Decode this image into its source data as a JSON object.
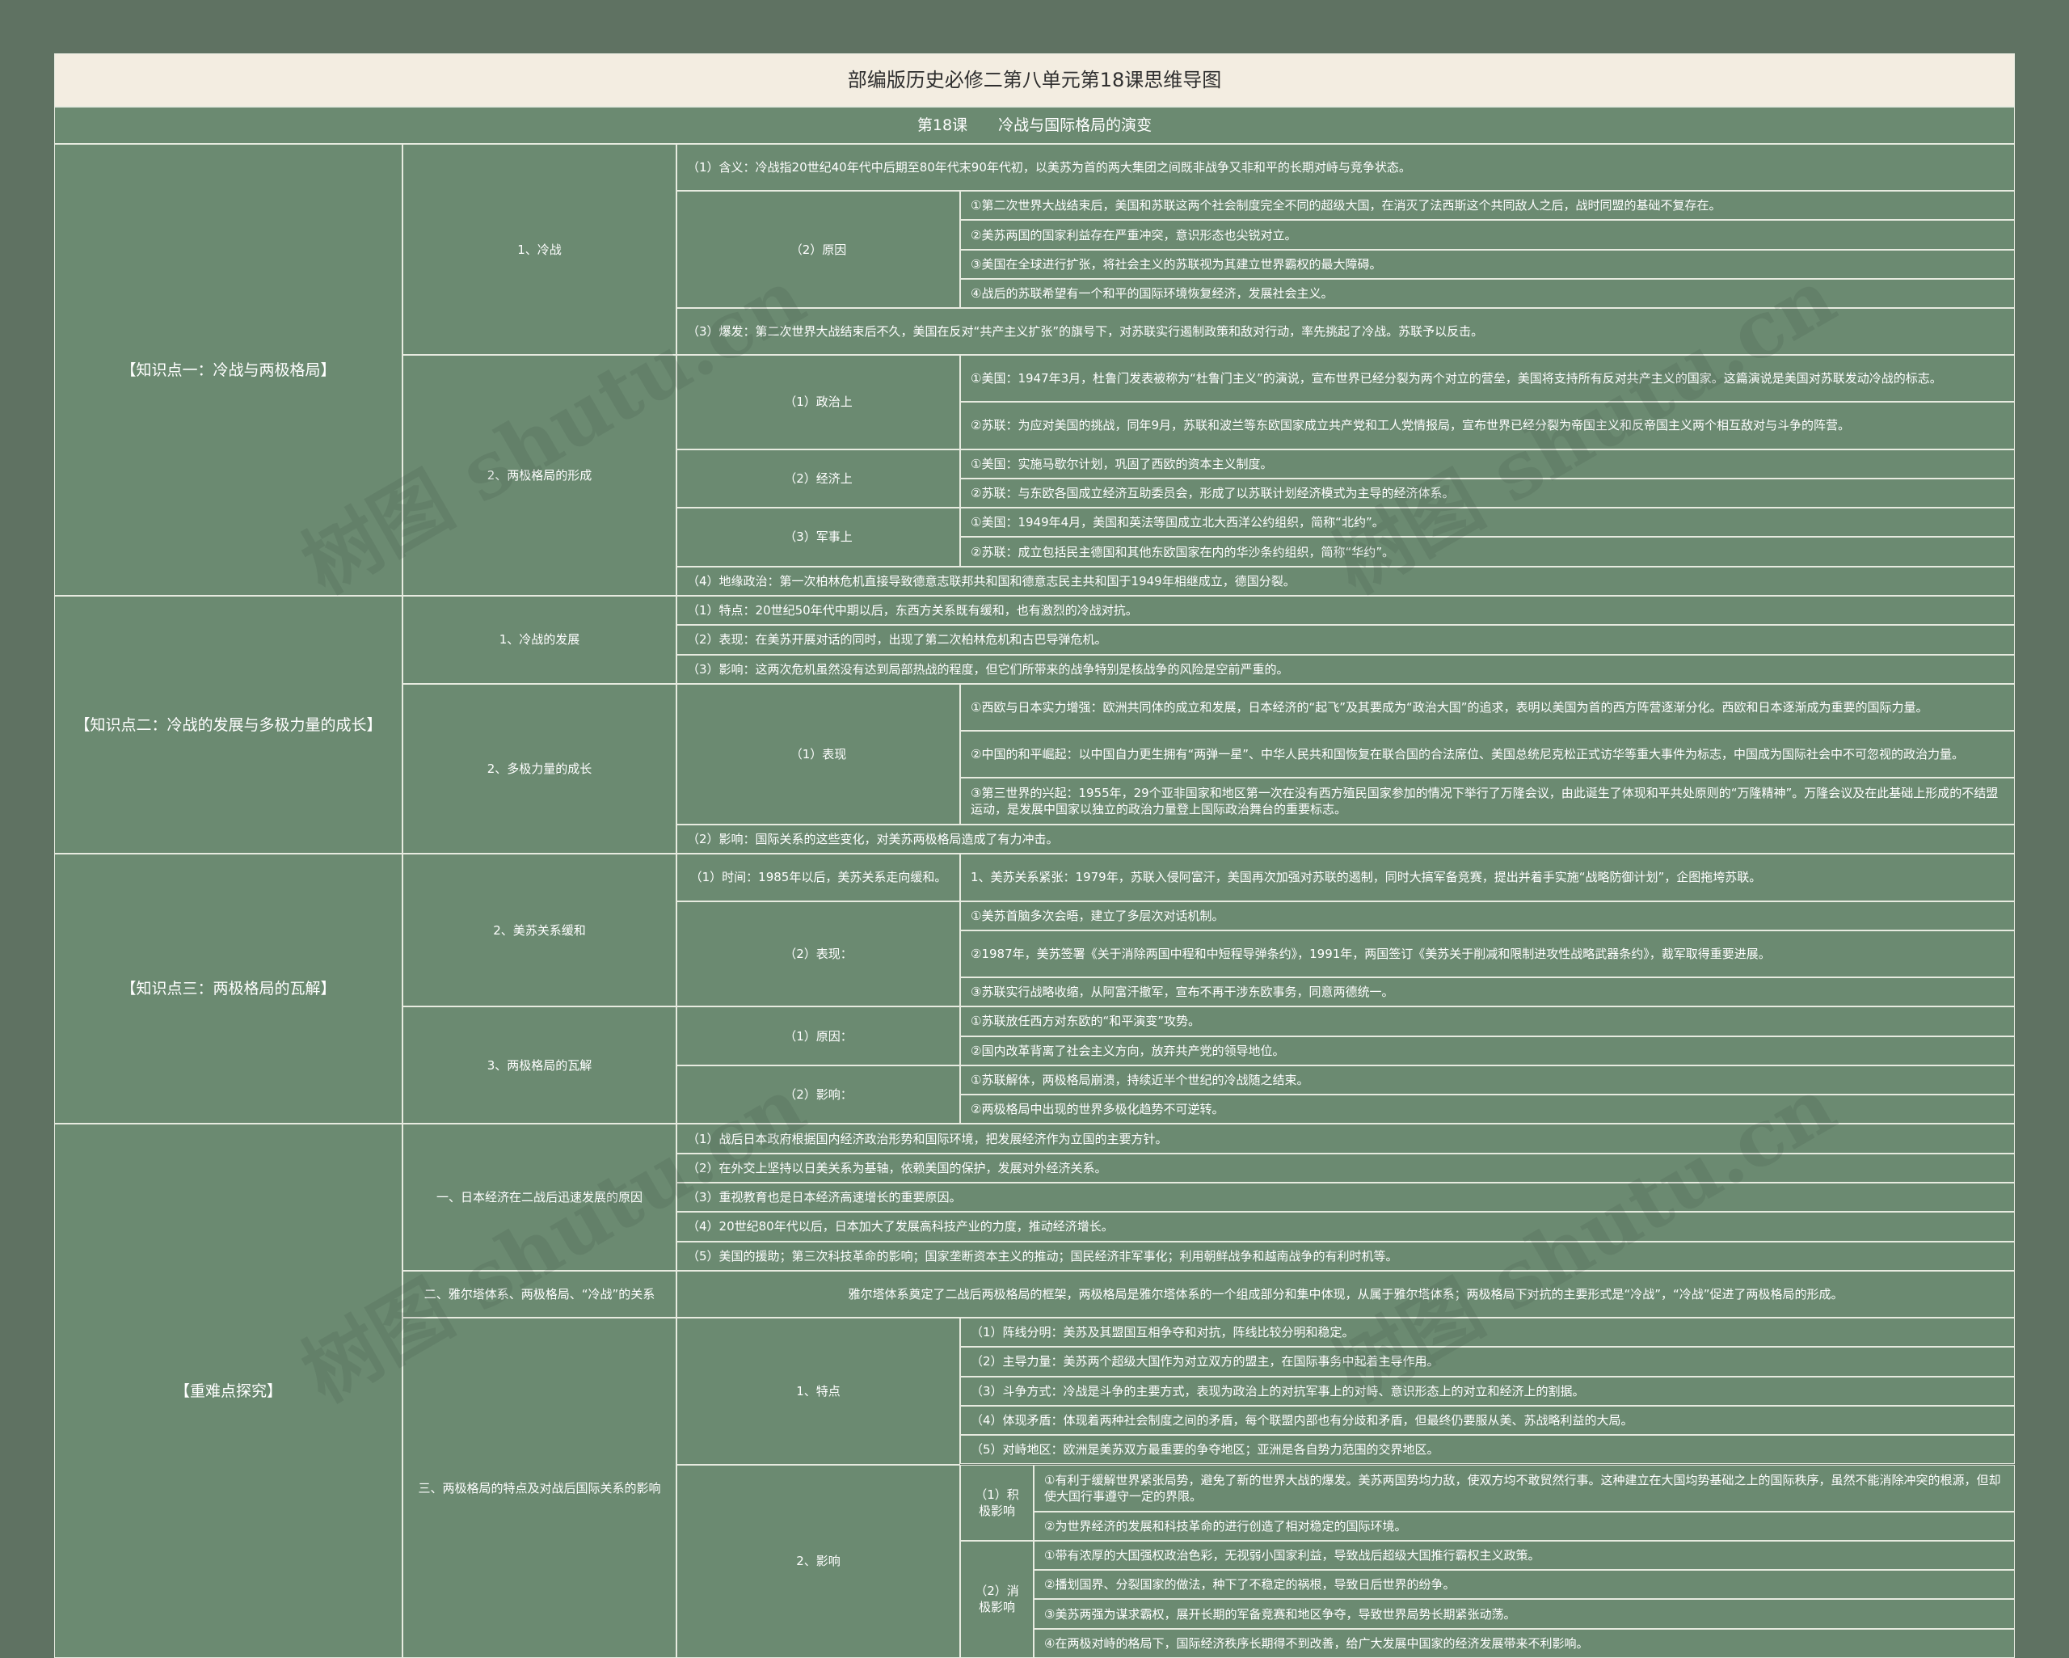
{
  "title": "部编版历史必修二第八单元第18课思维导图",
  "subtitle": "第18课　　冷战与国际格局的演变",
  "watermark": "树图 shutu.cn",
  "sections": [
    {
      "name": "【知识点一：冷战与两极格局】",
      "level2": [
        {
          "name": "1、冷战",
          "level3": [
            {
              "text": "（1）含义：冷战指20世纪40年代中后期至80年代末90年代初，以美苏为首的两大集团之间既非战争又非和平的长期对峙与竞争状态。"
            },
            {
              "name": "（2）原因",
              "level4": [
                "①第二次世界大战结束后，美国和苏联这两个社会制度完全不同的超级大国，在消灭了法西斯这个共同敌人之后，战时同盟的基础不复存在。",
                "②美苏两国的国家利益存在严重冲突，意识形态也尖锐对立。",
                "③美国在全球进行扩张，将社会主义的苏联视为其建立世界霸权的最大障碍。",
                "④战后的苏联希望有一个和平的国际环境恢复经济，发展社会主义。"
              ]
            },
            {
              "text": "（3）爆发：第二次世界大战结束后不久，美国在反对“共产主义扩张”的旗号下，对苏联实行遏制政策和敌对行动，率先挑起了冷战。苏联予以反击。"
            }
          ]
        },
        {
          "name": "2、两极格局的形成",
          "level3": [
            {
              "name": "（1）政治上",
              "level4": [
                "①美国：1947年3月，杜鲁门发表被称为“杜鲁门主义”的演说，宣布世界已经分裂为两个对立的营垒，美国将支持所有反对共产主义的国家。这篇演说是美国对苏联发动冷战的标志。",
                "②苏联：为应对美国的挑战，同年9月，苏联和波兰等东欧国家成立共产党和工人党情报局，宣布世界已经分裂为帝国主义和反帝国主义两个相互敌对与斗争的阵营。"
              ]
            },
            {
              "name": "（2）经济上",
              "level4": [
                "①美国：实施马歇尔计划，巩固了西欧的资本主义制度。",
                "②苏联：与东欧各国成立经济互助委员会，形成了以苏联计划经济模式为主导的经济体系。"
              ]
            },
            {
              "name": "（3）军事上",
              "level4": [
                "①美国：1949年4月，美国和英法等国成立北大西洋公约组织，简称“北约”。",
                "②苏联：成立包括民主德国和其他东欧国家在内的华沙条约组织，简称“华约”。"
              ]
            },
            {
              "text": "（4）地缘政治：第一次柏林危机直接导致德意志联邦共和国和德意志民主共和国于1949年相继成立，德国分裂。"
            }
          ]
        }
      ]
    },
    {
      "name": "【知识点二：冷战的发展与多极力量的成长】",
      "level2": [
        {
          "name": "1、冷战的发展",
          "level3": [
            {
              "text": "（1）特点：20世纪50年代中期以后，东西方关系既有缓和，也有激烈的冷战对抗。"
            },
            {
              "text": "（2）表现：在美苏开展对话的同时，出现了第二次柏林危机和古巴导弹危机。"
            },
            {
              "text": "（3）影响：这两次危机虽然没有达到局部热战的程度，但它们所带来的战争特别是核战争的风险是空前严重的。"
            }
          ]
        },
        {
          "name": "2、多极力量的成长",
          "level3": [
            {
              "name": "（1）表现",
              "level4": [
                "①西欧与日本实力增强：欧洲共同体的成立和发展，日本经济的“起飞”及其要成为“政治大国”的追求，表明以美国为首的西方阵营逐渐分化。西欧和日本逐渐成为重要的国际力量。",
                "②中国的和平崛起：以中国自力更生拥有“两弹一星”、中华人民共和国恢复在联合国的合法席位、美国总统尼克松正式访华等重大事件为标志，中国成为国际社会中不可忽视的政治力量。",
                "③第三世界的兴起：1955年，29个亚非国家和地区第一次在没有西方殖民国家参加的情况下举行了万隆会议，由此诞生了体现和平共处原则的“万隆精神”。万隆会议及在此基础上形成的不结盟运动，是发展中国家以独立的政治力量登上国际政治舞台的重要标志。"
              ]
            },
            {
              "text": "（2）影响：国际关系的这些变化，对美苏两极格局造成了有力冲击。"
            }
          ]
        }
      ]
    },
    {
      "name": "【知识点三：两极格局的瓦解】",
      "level2": [
        {
          "name": "2、美苏关系缓和",
          "level3": [
            {
              "name": "（1）时间：1985年以后，美苏关系走向缓和。",
              "level4": [
                "1、美苏关系紧张：1979年，苏联入侵阿富汗，美国再次加强对苏联的遏制，同时大搞军备竞赛，提出并着手实施“战略防御计划”，企图拖垮苏联。"
              ]
            },
            {
              "name": "（2）表现：",
              "level4": [
                "①美苏首脑多次会晤，建立了多层次对话机制。",
                "②1987年，美苏签署《关于消除两国中程和中短程导弹条约》，1991年，两国签订《美苏关于削减和限制进攻性战略武器条约》，裁军取得重要进展。",
                "③苏联实行战略收缩，从阿富汗撤军，宣布不再干涉东欧事务，同意两德统一。"
              ]
            }
          ]
        },
        {
          "name": "3、两极格局的瓦解",
          "level3": [
            {
              "name": "（1）原因：",
              "level4": [
                "①苏联放任西方对东欧的“和平演变”攻势。",
                "②国内改革背离了社会主义方向，放弃共产党的领导地位。"
              ]
            },
            {
              "name": "（2）影响：",
              "level4": [
                "①苏联解体，两极格局崩溃，持续近半个世纪的冷战随之结束。",
                "②两极格局中出现的世界多极化趋势不可逆转。"
              ]
            }
          ]
        }
      ]
    },
    {
      "name": "【重难点探究】",
      "level2": [
        {
          "name": "一、日本经济在二战后迅速发展的原因",
          "level3": [
            {
              "text": "（1）战后日本政府根据国内经济政治形势和国际环境，把发展经济作为立国的主要方针。"
            },
            {
              "text": "（2）在外交上坚持以日美关系为基轴，依赖美国的保护，发展对外经济关系。"
            },
            {
              "text": "（3）重视教育也是日本经济高速增长的重要原因。"
            },
            {
              "text": "（4）20世纪80年代以后，日本加大了发展高科技产业的力度，推动经济增长。"
            },
            {
              "text": "（5）美国的援助；第三次科技革命的影响；国家垄断资本主义的推动；国民经济非军事化；利用朝鲜战争和越南战争的有利时机等。"
            }
          ]
        },
        {
          "name": "二、雅尔塔体系、两极格局、“冷战”的关系",
          "text": "雅尔塔体系奠定了二战后两极格局的框架，两极格局是雅尔塔体系的一个组成部分和集中体现，从属于雅尔塔体系；两极格局下对抗的主要形式是“冷战”，“冷战”促进了两极格局的形成。"
        },
        {
          "name": "三、两极格局的特点及对战后国际关系的影响",
          "level3": [
            {
              "name": "1、特点",
              "level4": [
                "（1）阵线分明：美苏及其盟国互相争夺和对抗，阵线比较分明和稳定。",
                "（2）主导力量：美苏两个超级大国作为对立双方的盟主，在国际事务中起着主导作用。",
                "（3）斗争方式：冷战是斗争的主要方式，表现为政治上的对抗军事上的对峙、意识形态上的对立和经济上的割据。",
                "（4）体现矛盾：体现着两种社会制度之间的矛盾，每个联盟内部也有分歧和矛盾，但最终仍要服从美、苏战略利益的大局。",
                "（5）对峙地区：欧洲是美苏双方最重要的争夺地区；亚洲是各自势力范围的交界地区。"
              ]
            },
            {
              "name": "2、影响",
              "level4": [
                {
                  "name": "（1）积极影响",
                  "level5": [
                    "①有利于缓解世界紧张局势，避免了新的世界大战的爆发。美苏两国势均力敌，使双方均不敢贸然行事。这种建立在大国均势基础之上的国际秩序，虽然不能消除冲突的根源，但却使大国行事遵守一定的界限。",
                    "②为世界经济的发展和科技革命的进行创造了相对稳定的国际环境。"
                  ]
                },
                {
                  "name": "（2）消极影响",
                  "level5": [
                    "①带有浓厚的大国强权政治色彩，无视弱小国家利益，导致战后超级大国推行霸权主义政策。",
                    "②播划国界、分裂国家的做法，种下了不稳定的祸根，导致日后世界的纷争。",
                    "③美苏两强为谋求霸权，展开长期的军备竞赛和地区争夺，导致世界局势长期紧张动荡。",
                    "④在两极对峙的格局下，国际经济秩序长期得不到改善，给广大发展中国家的经济发展带来不利影响。"
                  ]
                }
              ]
            }
          ]
        }
      ]
    }
  ]
}
